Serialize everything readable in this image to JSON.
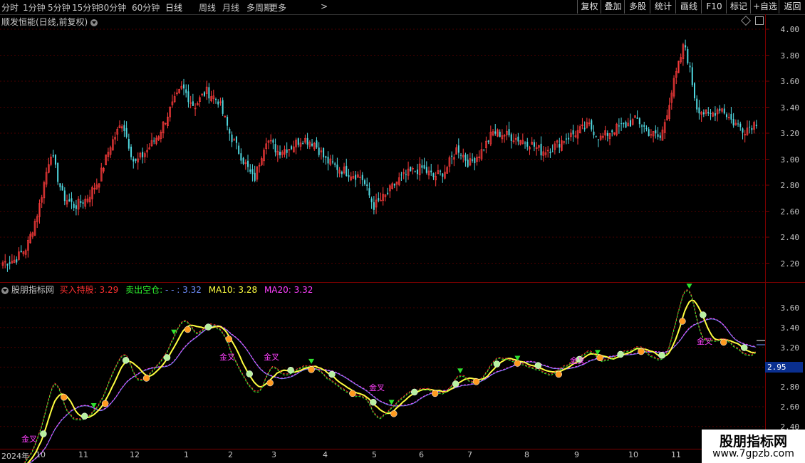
{
  "toolbar": {
    "periods": [
      "分时",
      "1分钟",
      "5分钟",
      "15分钟",
      "30分钟",
      "60分钟",
      "日线",
      "周线",
      "月线",
      "多周期",
      "更多"
    ],
    "active_period": "日线",
    "more_arrow": ">",
    "buttons": [
      "复权",
      "叠加",
      "多股",
      "统计",
      "画线",
      "F10",
      "标记",
      "+自选",
      "返回"
    ]
  },
  "main_panel": {
    "title": "顺发恒能(日线,前复权)",
    "price_ticks": [
      "4.00",
      "3.80",
      "3.60",
      "3.40",
      "3.20",
      "3.00",
      "2.80",
      "2.60",
      "2.40",
      "2.20"
    ]
  },
  "indicator_panel": {
    "title": "股朋指标网",
    "buy_label": "买入持股:",
    "buy_value": "3.29",
    "sell_label": "卖出空仓:",
    "sell_mid": "- -",
    "sell_value": ": 3.32",
    "ma10_label": "MA10:",
    "ma10_value": "3.28",
    "ma20_label": "MA20:",
    "ma20_value": "3.32",
    "ticks": [
      "3.60",
      "3.40",
      "3.20",
      "3.00",
      "2.80",
      "2.60",
      "2.40"
    ],
    "cursor_value": "2.95",
    "annotation": "金叉",
    "colors": {
      "buy": "#ff3030",
      "sell": "#30ff30",
      "ma10": "#ffff40",
      "ma20": "#ff40ff"
    }
  },
  "x_axis": {
    "labels": [
      "2024年",
      "10",
      "11",
      "12",
      "1",
      "2",
      "3",
      "4",
      "5",
      "6",
      "7",
      "8",
      "9",
      "10",
      "11"
    ]
  },
  "watermark": {
    "title": "股朋指标网",
    "url": "www.7gpzb.com"
  },
  "chart_data": {
    "type": "candlestick",
    "title": "顺发恒能(日线,前复权)",
    "ylim": [
      2.1,
      4.05
    ],
    "x_months": [
      "2024年",
      "10",
      "11",
      "12",
      "1",
      "2",
      "3",
      "4",
      "5",
      "6",
      "7",
      "8",
      "9",
      "10",
      "11"
    ],
    "close_approx": [
      2.18,
      2.2,
      2.3,
      2.6,
      3.05,
      2.7,
      2.62,
      2.68,
      2.82,
      3.1,
      3.28,
      2.95,
      3.05,
      3.18,
      3.38,
      3.55,
      3.4,
      3.52,
      3.45,
      3.18,
      3.0,
      2.82,
      3.15,
      3.05,
      3.08,
      3.15,
      3.12,
      2.98,
      2.92,
      2.88,
      2.85,
      2.62,
      2.7,
      2.82,
      2.88,
      2.92,
      2.85,
      2.9,
      3.08,
      2.95,
      3.05,
      3.2,
      3.18,
      3.15,
      3.12,
      3.05,
      3.08,
      3.15,
      3.2,
      3.25,
      3.15,
      3.22,
      3.25,
      3.3,
      3.2,
      3.15,
      3.55,
      3.9,
      3.4,
      3.32,
      3.4,
      3.28,
      3.22,
      3.28
    ]
  }
}
